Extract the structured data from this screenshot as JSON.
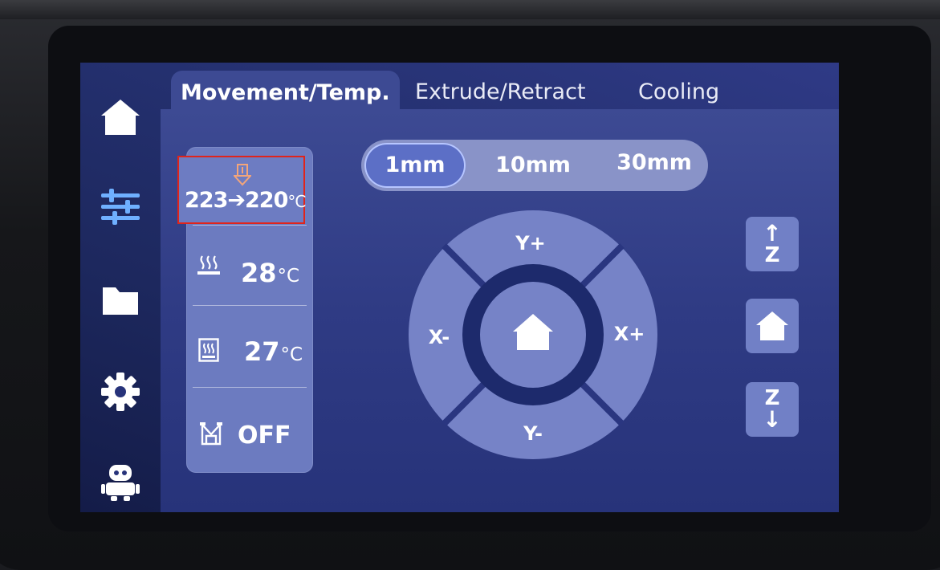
{
  "tabs": [
    {
      "label": "Movement/Temp.",
      "active": true
    },
    {
      "label": "Extrude/Retract",
      "active": false
    },
    {
      "label": "Cooling",
      "active": false
    }
  ],
  "sidebar": {
    "items": [
      {
        "name": "home",
        "icon": "home-icon"
      },
      {
        "name": "controls",
        "icon": "sliders-icon",
        "active": true
      },
      {
        "name": "files",
        "icon": "folder-icon"
      },
      {
        "name": "settings",
        "icon": "gear-icon"
      },
      {
        "name": "assistant",
        "icon": "robot-icon"
      }
    ]
  },
  "temperatures": {
    "hotend": {
      "icon": "nozzle-icon",
      "current": "223",
      "arrow": "➔",
      "target": "220",
      "unit": "°C",
      "highlighted": true
    },
    "bed": {
      "icon": "heated-bed-icon",
      "value": "28",
      "unit": "°C"
    },
    "chamber": {
      "icon": "chamber-icon",
      "value": "27",
      "unit": "°C"
    },
    "motors": {
      "icon": "motor-icon",
      "value": "OFF"
    }
  },
  "step_sizes": {
    "options": [
      "1mm",
      "10mm",
      "30mm"
    ],
    "selected": "1mm"
  },
  "jog": {
    "y_plus": "Y+",
    "y_minus": "Y-",
    "x_minus": "X-",
    "x_plus": "X+",
    "center": "home-icon"
  },
  "z_controls": {
    "up_label": "Z",
    "down_label": "Z",
    "up_icon": "arrow-up-icon",
    "down_icon": "arrow-down-icon",
    "home_icon": "home-icon"
  },
  "colors": {
    "accent": "#5c6fc6",
    "highlight_border": "#e0241b",
    "hotend_icon": "#f3a57a",
    "active_nav": "#6fb0ff"
  }
}
